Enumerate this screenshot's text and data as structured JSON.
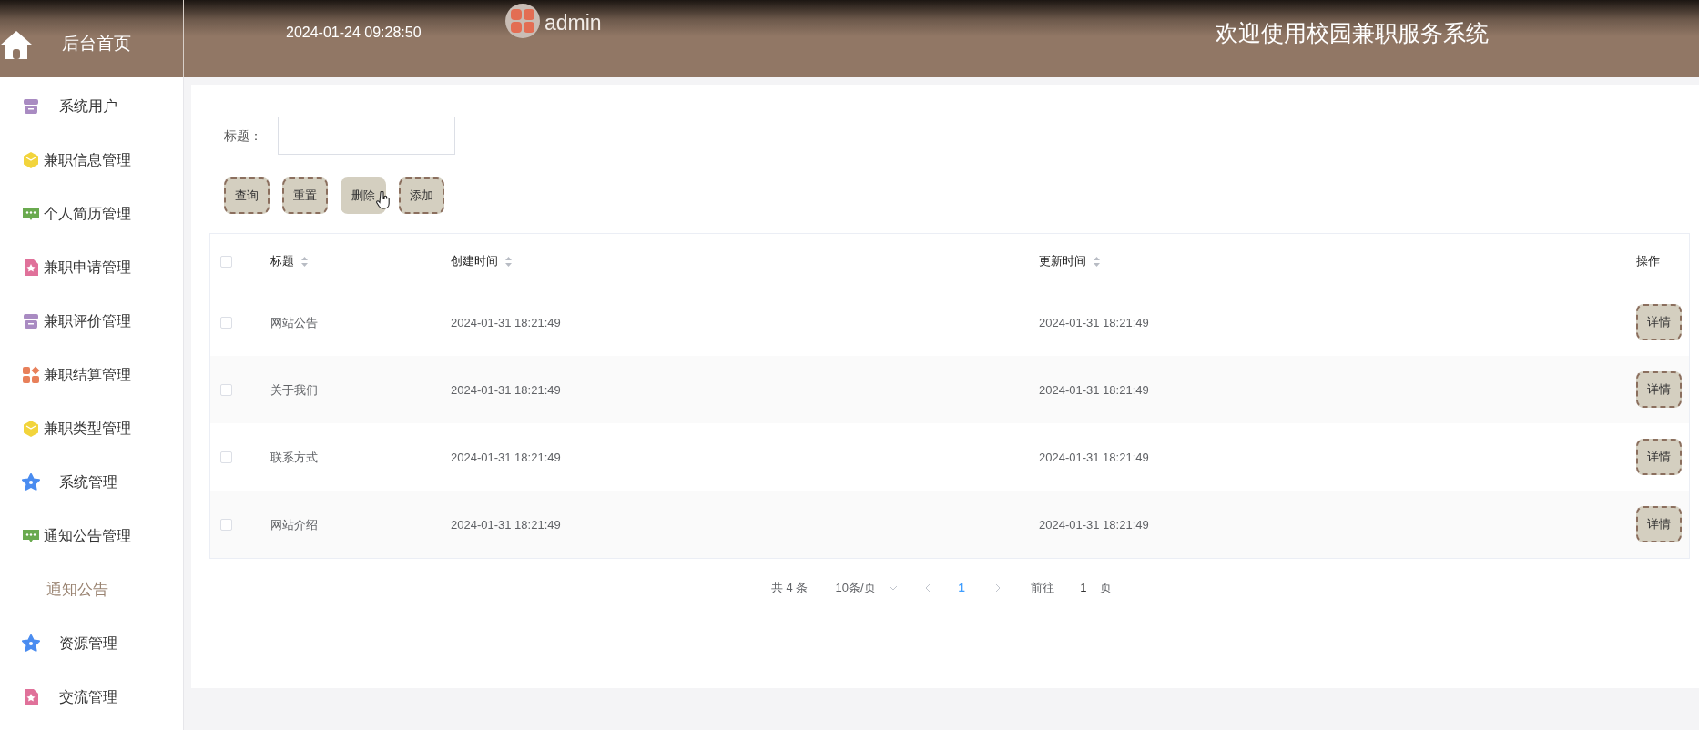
{
  "header": {
    "home_label": "后台首页",
    "datetime": "2024-01-24 09:28:50",
    "user": "admin",
    "title": "欢迎使用校园兼职服务系统"
  },
  "sidebar": {
    "items": [
      {
        "label": "系统用户",
        "kind": "menu",
        "color": "#a98bc2"
      },
      {
        "label": "兼职信息管理",
        "kind": "menu",
        "color": "#f2d43c"
      },
      {
        "label": "个人简历管理",
        "kind": "menu",
        "color": "#6aaa4f"
      },
      {
        "label": "兼职申请管理",
        "kind": "menu",
        "color": "#e0719a"
      },
      {
        "label": "兼职评价管理",
        "kind": "menu",
        "color": "#a98bc2"
      },
      {
        "label": "兼职结算管理",
        "kind": "menu",
        "color": "#e8805a"
      },
      {
        "label": "兼职类型管理",
        "kind": "menu",
        "color": "#f2d43c"
      },
      {
        "label": "系统管理",
        "kind": "menu",
        "color": "#4a8cf0"
      },
      {
        "label": "通知公告管理",
        "kind": "menu",
        "color": "#6aaa4f"
      },
      {
        "label": "通知公告",
        "kind": "submenu"
      },
      {
        "label": "资源管理",
        "kind": "menu",
        "color": "#4a8cf0"
      },
      {
        "label": "交流管理",
        "kind": "menu",
        "color": "#e0719a"
      }
    ]
  },
  "search": {
    "label": "标题："
  },
  "buttons": [
    {
      "label": "查询",
      "hovered": false
    },
    {
      "label": "重置",
      "hovered": false
    },
    {
      "label": "删除",
      "hovered": true
    },
    {
      "label": "添加",
      "hovered": false
    }
  ],
  "table": {
    "select_all_checked": false,
    "columns": [
      "标题",
      "创建时间",
      "更新时间",
      "操作"
    ],
    "rows": [
      {
        "title": "网站公告",
        "created": "2024-01-31 18:21:49",
        "updated": "2024-01-31 18:21:49",
        "action": "详情",
        "checked": false
      },
      {
        "title": "关于我们",
        "created": "2024-01-31 18:21:49",
        "updated": "2024-01-31 18:21:49",
        "action": "详情",
        "checked": false
      },
      {
        "title": "联系方式",
        "created": "2024-01-31 18:21:49",
        "updated": "2024-01-31 18:21:49",
        "action": "详情",
        "checked": false
      },
      {
        "title": "网站介绍",
        "created": "2024-01-31 18:21:49",
        "updated": "2024-01-31 18:21:49",
        "action": "详情",
        "checked": false
      }
    ]
  },
  "pagination": {
    "total": "共 4 条",
    "page_size": "10条/页",
    "current_page": "1",
    "goto_label": "前往",
    "goto_value": "1",
    "page_suffix": "页"
  }
}
